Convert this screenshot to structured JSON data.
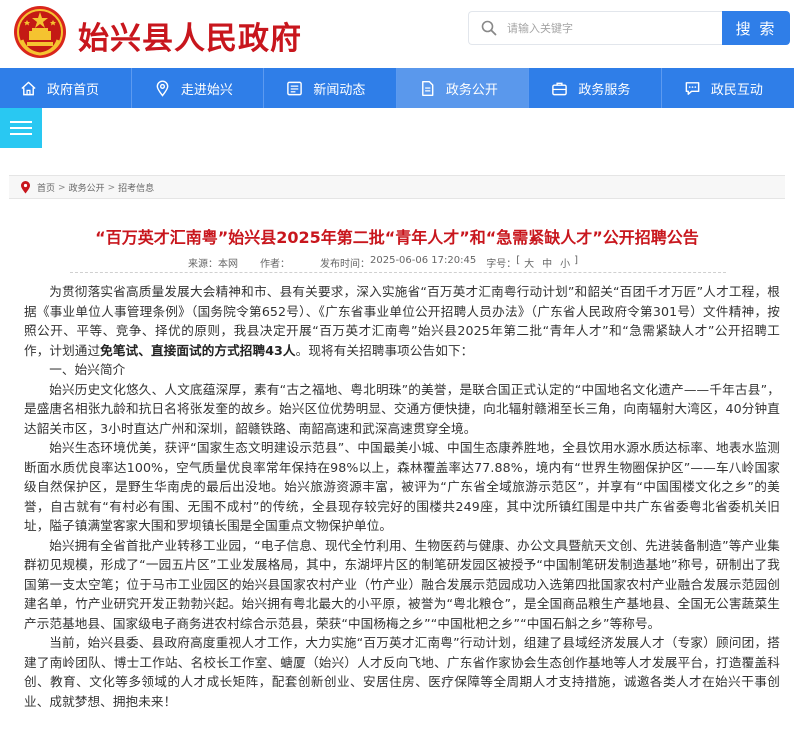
{
  "header": {
    "site_title": "始兴县人民政府",
    "search_placeholder": "请输入关键字",
    "search_button": "搜 索"
  },
  "nav": {
    "items": [
      {
        "label": "政府首页",
        "icon": "home-icon"
      },
      {
        "label": "走进始兴",
        "icon": "location-icon"
      },
      {
        "label": "新闻动态",
        "icon": "news-icon"
      },
      {
        "label": "政务公开",
        "icon": "document-icon"
      },
      {
        "label": "政务服务",
        "icon": "briefcase-icon"
      },
      {
        "label": "政民互动",
        "icon": "chat-icon"
      }
    ],
    "active_index": 3
  },
  "breadcrumb": [
    "首页",
    "政务公开",
    "招考信息"
  ],
  "article": {
    "title": "“百万英才汇南粤”始兴县2025年第二批“青年人才”和“急需紧缺人才”公开招聘公告",
    "source_label": "来源：",
    "source": "本网",
    "author_label": "作者：",
    "author": "",
    "date_label": "发布时间：",
    "date": "2025-06-06 17:20:45",
    "font_size_label": "字号：",
    "font_sizes": [
      "大",
      "中",
      "小"
    ],
    "intro_a": "为贯彻落实省高质量发展大会精神和市、县有关要求，深入实施省“百万英才汇南粤行动计划”和韶关“百团千才万匠”人才工程，根据《事业单位人事管理条例》（国务院令第652号）、《广东省事业单位公开招聘人员办法》（广东省人民政府令第301号）文件精神，按照公开、平等、竞争、择优的原则，我县决定开展“百万英才汇南粤”始兴县2025年第二批“青年人才”和“急需紧缺人才”公开招聘工作，计划通过",
    "intro_bold": "免笔试、直接面试的方式招聘43人",
    "intro_b": "。现将有关招聘事项公告如下：",
    "section1": "一、始兴简介",
    "para1": "始兴历史文化悠久、人文底蕴深厚，素有“古之福地、粤北明珠”的美誉，是联合国正式认定的“中国地名文化遗产——千年古县”，是盛唐名相张九龄和抗日名将张发奎的故乡。始兴区位优势明显、交通方便快捷，向北辐射赣湘至长三角，向南辐射大湾区，40分钟直达韶关市区，3小时直达广州和深圳，韶赣铁路、南韶高速和武深高速贯穿全境。",
    "para2": "始兴生态环境优美，获评“国家生态文明建设示范县”、中国最美小城、中国生态康养胜地，全县饮用水源水质达标率、地表水监测断面水质优良率达100%，空气质量优良率常年保持在98%以上，森林覆盖率达77.88%，境内有“世界生物圈保护区”——车八岭国家级自然保护区，是野生华南虎的最后出没地。始兴旅游资源丰富，被评为“广东省全域旅游示范区”，并享有“中国围楼文化之乡”的美誉，自古就有“有村必有围、无围不成村”的传统，全县现存较完好的围楼共249座，其中沈所镇红围是中共广东省委粤北省委机关旧址，隘子镇满堂客家大围和罗坝镇长围是全国重点文物保护单位。",
    "para3": "始兴拥有全省首批产业转移工业园，“电子信息、现代全竹利用、生物医药与健康、办公文具暨航天文创、先进装备制造”等产业集群初见规模，形成了“一园五片区”工业发展格局，其中，东湖坪片区的制笔研发园区被授予“中国制笔研发制造基地”称号，研制出了我国第一支太空笔；位于马市工业园区的始兴县国家农村产业（竹产业）融合发展示范园成功入选第四批国家农村产业融合发展示范园创建名单，竹产业研究开发正勃勃兴起。始兴拥有粤北最大的小平原，被誉为“粤北粮仓”，是全国商品粮生产基地县、全国无公害蔬菜生产示范基地县、国家级电子商务进农村综合示范县，荣获“中国杨梅之乡”“中国枇杷之乡”“中国石斛之乡”等称号。",
    "para4": "当前，始兴县委、县政府高度重视人才工作，大力实施“百万英才汇南粤”行动计划，组建了县域经济发展人才（专家）顾问团，搭建了南岭团队、博士工作站、名校长工作室、螗厦（始兴）人才反向飞地、广东省作家协会生态创作基地等人才发展平台，打造覆盖科创、教育、文化等多领域的人才成长矩阵，配套创新创业、安居住房、医疗保障等全周期人才支持措施，诚邀各类人才在始兴干事创业、成就梦想、拥抱未来！"
  },
  "colors": {
    "brand_red": "#c8161d",
    "nav_blue": "#2f7ee8",
    "nav_active": "#5a98ec",
    "menu_cyan": "#29c8f2"
  }
}
